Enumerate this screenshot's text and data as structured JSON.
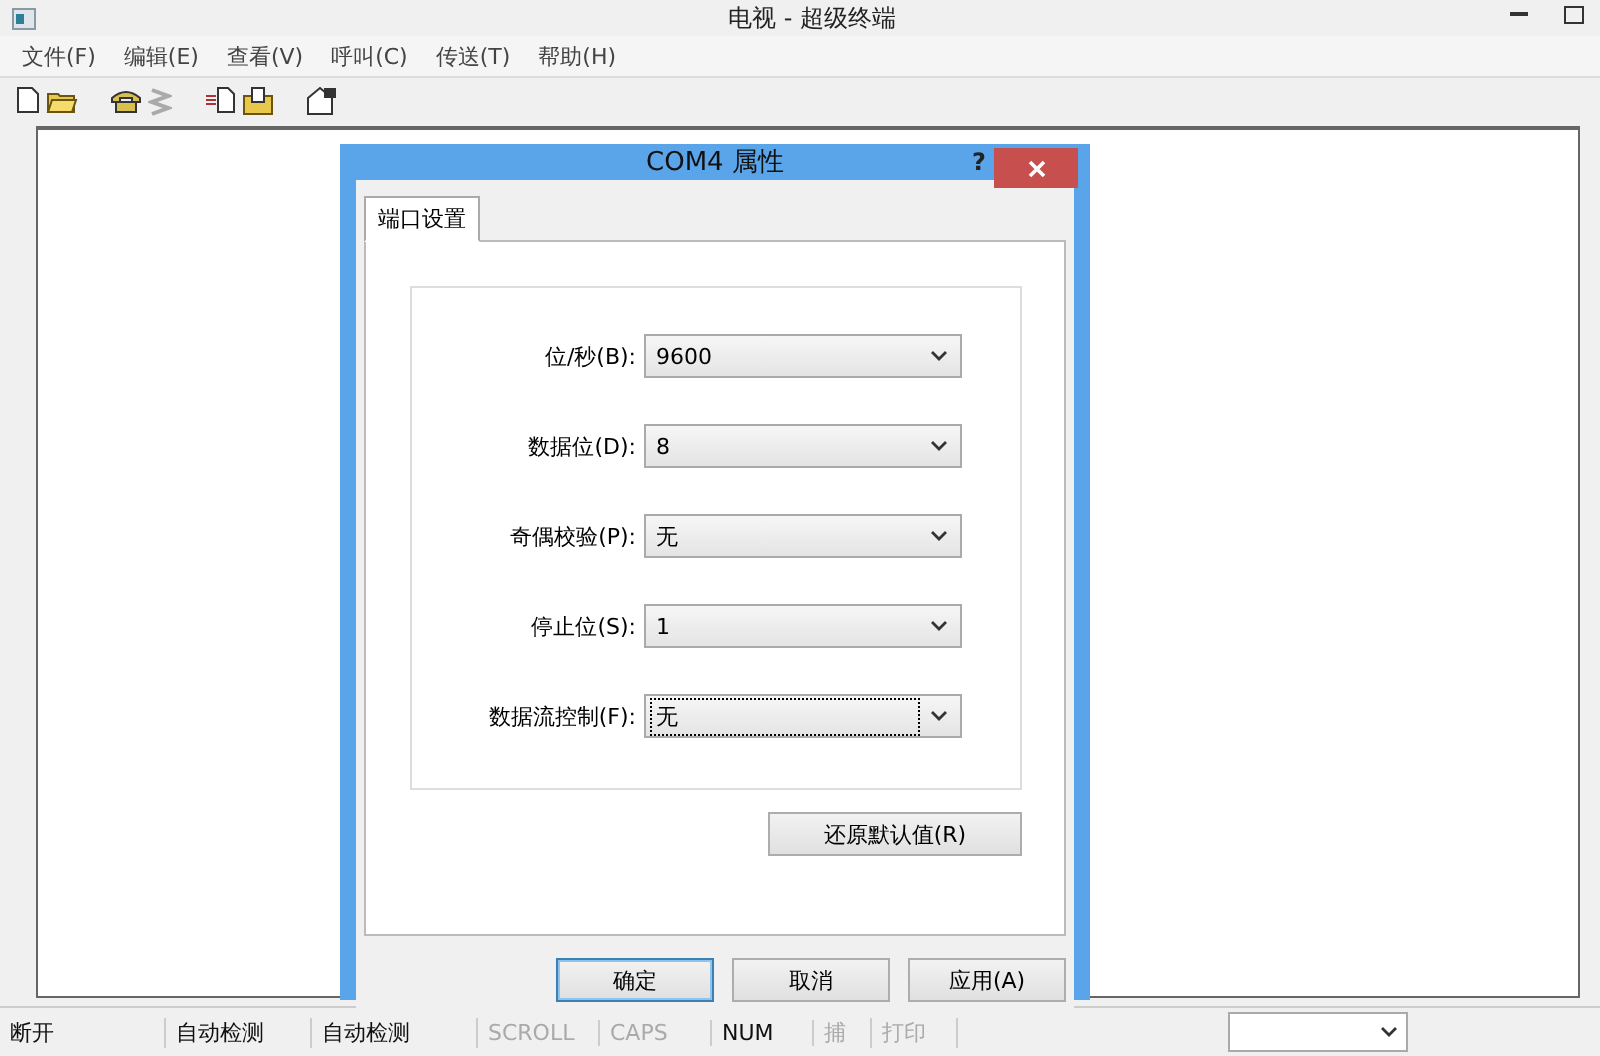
{
  "window": {
    "title": "电视 - 超级终端"
  },
  "menu": [
    "文件(F)",
    "编辑(E)",
    "查看(V)",
    "呼叫(C)",
    "传送(T)",
    "帮助(H)"
  ],
  "toolbar": [
    {
      "kind": "new"
    },
    {
      "kind": "open"
    },
    {
      "kind": "gap"
    },
    {
      "kind": "call"
    },
    {
      "kind": "hangup",
      "disabled": true
    },
    {
      "kind": "gap"
    },
    {
      "kind": "send"
    },
    {
      "kind": "receive"
    },
    {
      "kind": "gap"
    },
    {
      "kind": "properties"
    }
  ],
  "status_bar": [
    {
      "text": "断开",
      "active": true
    },
    {
      "text": "自动检测",
      "active": true
    },
    {
      "text": "自动检测",
      "active": true
    },
    {
      "text": "SCROLL",
      "active": false
    },
    {
      "text": "CAPS",
      "active": false
    },
    {
      "text": "NUM",
      "active": true
    },
    {
      "text": "捕",
      "active": false
    },
    {
      "text": "打印",
      "active": false
    }
  ],
  "dialog": {
    "title": "COM4 属性",
    "help": "?",
    "tabs": [
      {
        "label": "端口设置",
        "selected": true
      }
    ],
    "fields": [
      {
        "label": "位/秒(B):",
        "value": "9600",
        "focused": false
      },
      {
        "label": "数据位(D):",
        "value": "8",
        "focused": false
      },
      {
        "label": "奇偶校验(P):",
        "value": "无",
        "focused": false
      },
      {
        "label": "停止位(S):",
        "value": "1",
        "focused": false
      },
      {
        "label": "数据流控制(F):",
        "value": "无",
        "focused": true
      }
    ],
    "restore_button": "还原默认值(R)",
    "buttons": [
      {
        "label": "确定",
        "default": true
      },
      {
        "label": "取消",
        "default": false
      },
      {
        "label": "应用(A)",
        "default": false
      }
    ]
  }
}
